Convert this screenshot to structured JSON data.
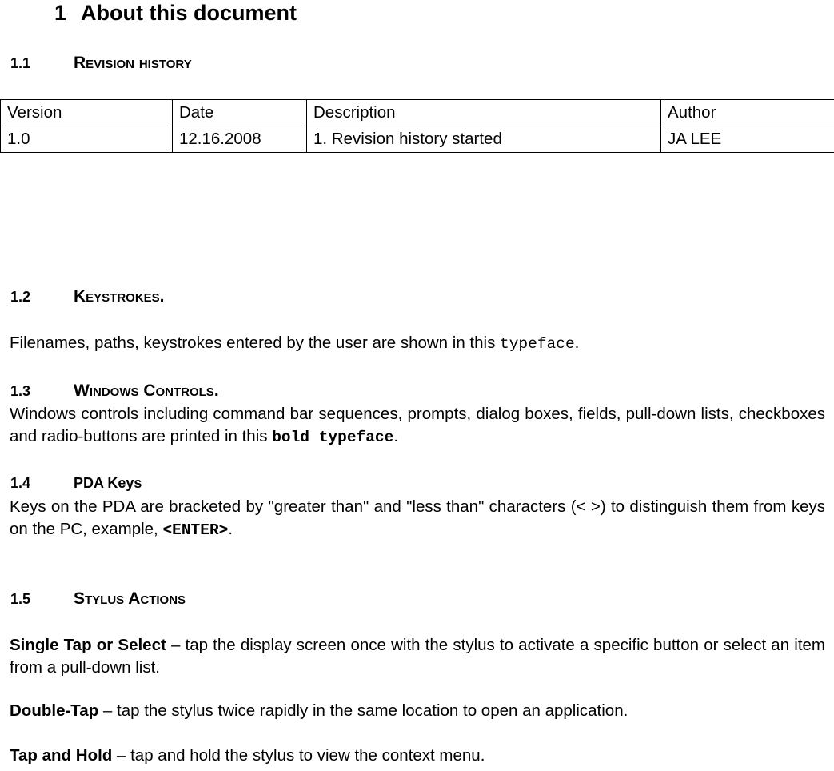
{
  "document": {
    "chapter": {
      "number": "1",
      "title": "About this document"
    },
    "sections": [
      {
        "number": "1.1",
        "label": "Revision history",
        "style": "smallcaps"
      },
      {
        "number": "1.2",
        "label": "Keystrokes.",
        "style": "smallcaps"
      },
      {
        "number": "1.3",
        "label": "Windows Controls.",
        "style": "smallcaps"
      },
      {
        "number": "1.4",
        "label": "PDA Keys",
        "style": "plain"
      },
      {
        "number": "1.5",
        "label": "Stylus Actions",
        "style": "smallcaps"
      }
    ],
    "revision_table": {
      "headers": [
        "Version",
        "Date",
        "Description",
        "Author"
      ],
      "rows": [
        [
          "1.0",
          "12.16.2008",
          "1. Revision history started",
          "JA LEE"
        ]
      ]
    },
    "keystrokes_paragraph": {
      "lead": "Filenames, paths, keystrokes entered by the user are shown in this ",
      "mono": "typeface",
      "tail": "."
    },
    "windows_controls_paragraph": {
      "lead": "Windows controls including command bar sequences, prompts, dialog boxes, fields, pull-down lists, checkboxes and radio-buttons are printed in this ",
      "mono_bold": "bold typeface",
      "tail": "."
    },
    "pda_keys_paragraph": {
      "lead": "Keys on the PDA are bracketed by \"greater than\" and \"less than\" characters (< >) to distinguish them from keys on the PC, example, ",
      "mono_bold": "<ENTER>",
      "tail": "."
    },
    "stylus_actions": [
      {
        "term": "Single Tap or Select",
        "description": " – tap the display screen once with the stylus to activate a specific button or select an item from a pull-down list."
      },
      {
        "term": "Double-Tap",
        "description": " – tap the stylus twice rapidly in the same location to open an application."
      },
      {
        "term": "Tap and Hold",
        "description": " – tap and hold the stylus to view the context menu."
      }
    ]
  }
}
